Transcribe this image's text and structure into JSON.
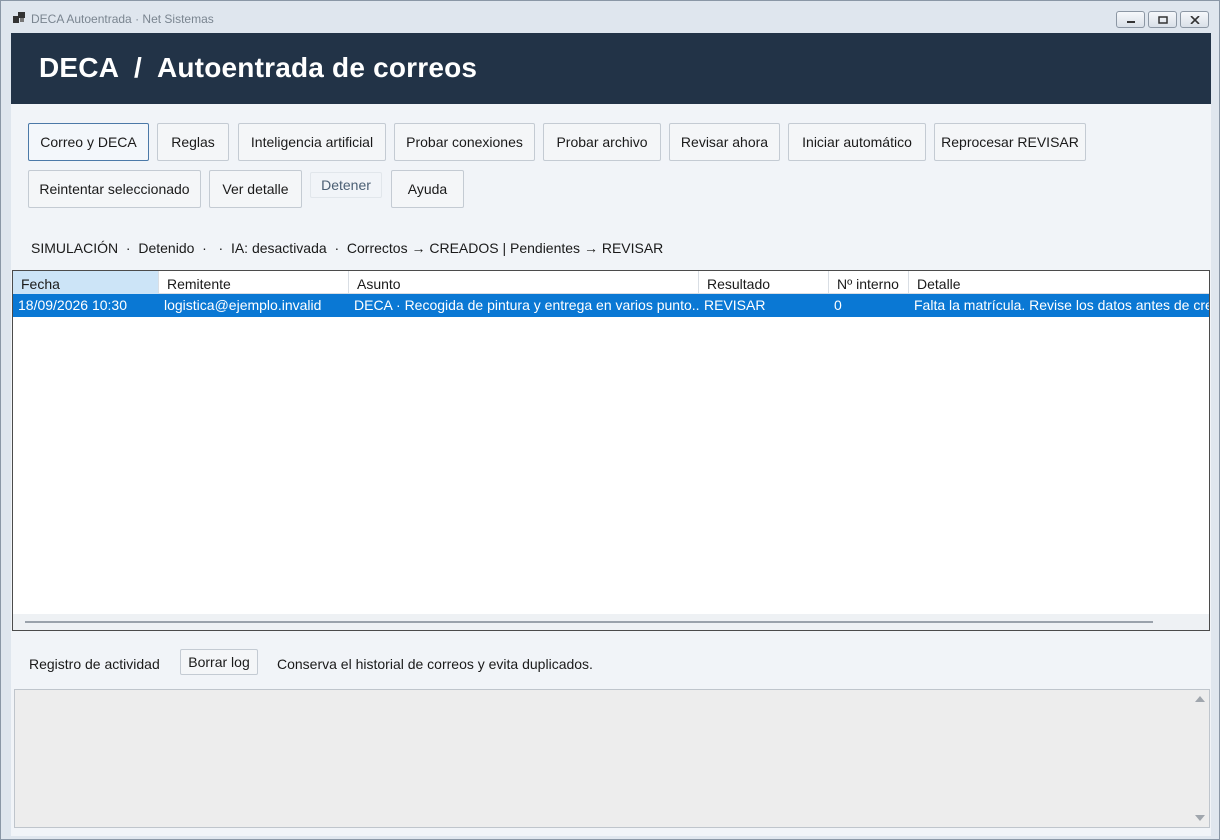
{
  "window": {
    "title": "DECA Autoentrada · Net Sistemas",
    "icon": "app-window-icon"
  },
  "header": {
    "title": "DECA  /  Autoentrada de correos"
  },
  "toolbar": {
    "correo_deca": "Correo y DECA",
    "reglas": "Reglas",
    "ia": "Inteligencia artificial",
    "probar_conexiones": "Probar conexiones",
    "probar_archivo": "Probar archivo",
    "revisar_ahora": "Revisar ahora",
    "iniciar_automatico": "Iniciar automático",
    "reprocesar": "Reprocesar REVISAR",
    "reintentar": "Reintentar seleccionado",
    "ver_detalle": "Ver detalle",
    "detener": "Detener",
    "ayuda": "Ayuda"
  },
  "status": {
    "text": "SIMULACIÓN  ·  Detenido  ·   ·  IA: desactivada  ·  Correctos → CREADOS | Pendientes → REVISAR"
  },
  "grid": {
    "columns": [
      "Fecha",
      "Remitente",
      "Asunto",
      "Resultado",
      "Nº interno",
      "Detalle"
    ],
    "rows": [
      {
        "fecha": "18/09/2026 10:30",
        "remitente": "logistica@ejemplo.invalid",
        "asunto": "DECA · Recogida de pintura y entrega en varios punto...",
        "resultado": "REVISAR",
        "interno": "0",
        "detalle": "Falta la matrícula. Revise los datos antes de crear"
      }
    ]
  },
  "log": {
    "label": "Registro de actividad",
    "clear_button": "Borrar log",
    "hint": "Conserva el historial de correos y evita duplicados."
  },
  "colors": {
    "header_bg": "#223347",
    "selection": "#0a78d4",
    "sorted_header": "#cce4f7"
  }
}
